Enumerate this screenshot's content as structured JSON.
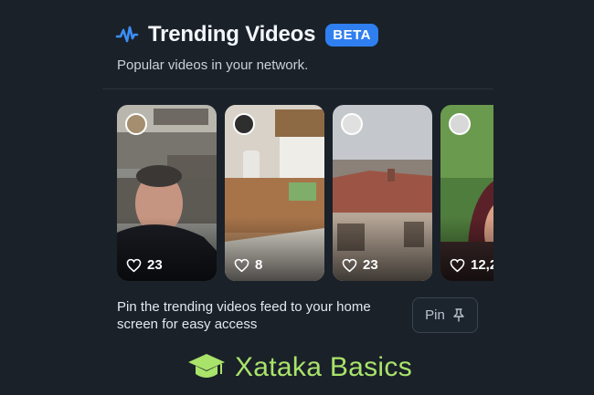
{
  "header": {
    "title": "Trending Videos",
    "badge": "BETA",
    "subtitle": "Popular videos in your network.",
    "icon": "activity-wave-icon"
  },
  "videos": [
    {
      "likes": "23",
      "avatar": "user-avatar",
      "scene": "rubble-street-selfie"
    },
    {
      "likes": "8",
      "avatar": "user-avatar",
      "scene": "room-interior"
    },
    {
      "likes": "23",
      "avatar": "user-avatar",
      "scene": "rooftops-sky"
    },
    {
      "likes": "12,2",
      "avatar": "user-avatar",
      "scene": "woman-plants"
    }
  ],
  "pin": {
    "text": "Pin the trending videos feed to your home screen for easy access",
    "button_label": "Pin"
  },
  "brand": {
    "text": "Xataka Basics",
    "color": "#a9e36a"
  },
  "colors": {
    "background": "#1a2129",
    "accent": "#2f7ff0"
  }
}
